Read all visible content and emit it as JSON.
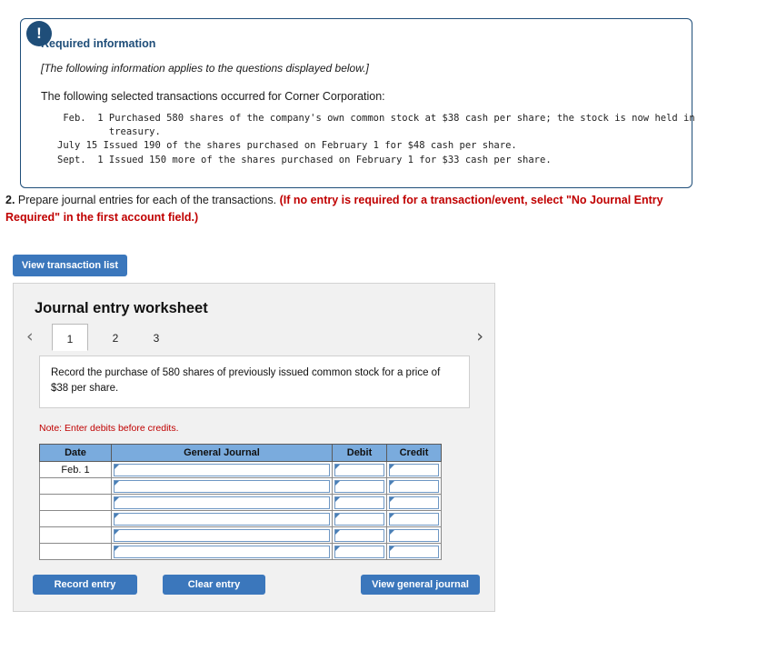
{
  "required_info": {
    "badge_icon": "exclamation-icon",
    "title": "Required information",
    "italic_note": "[The following information applies to the questions displayed below.]",
    "lead": "The following selected transactions occurred for Corner Corporation:",
    "transactions_text": " Feb.  1 Purchased 580 shares of the company's own common stock at $38 cash per share; the stock is now held in\n         treasury.\nJuly 15 Issued 190 of the shares purchased on February 1 for $48 cash per share.\nSept.  1 Issued 150 more of the shares purchased on February 1 for $33 cash per share."
  },
  "question": {
    "number": "2.",
    "text": "Prepare journal entries for each of the transactions.",
    "red_text": "(If no entry is required for a transaction/event, select \"No Journal Entry Required\" in the first account field.)"
  },
  "buttons": {
    "view_transaction_list": "View transaction list",
    "record_entry": "Record entry",
    "clear_entry": "Clear entry",
    "view_general_journal": "View general journal"
  },
  "worksheet": {
    "title": "Journal entry worksheet",
    "prev_arrow": "‹",
    "next_arrow": "›",
    "tabs": [
      {
        "label": "1",
        "active": true
      },
      {
        "label": "2",
        "active": false
      },
      {
        "label": "3",
        "active": false
      }
    ],
    "prompt": "Record the purchase of 580 shares of previously issued common stock for a price of $38 per share.",
    "note": "Note: Enter debits before credits.",
    "table": {
      "headers": [
        "Date",
        "General Journal",
        "Debit",
        "Credit"
      ],
      "rows": [
        {
          "date": "Feb. 1",
          "general_journal": "",
          "debit": "",
          "credit": ""
        },
        {
          "date": "",
          "general_journal": "",
          "debit": "",
          "credit": ""
        },
        {
          "date": "",
          "general_journal": "",
          "debit": "",
          "credit": ""
        },
        {
          "date": "",
          "general_journal": "",
          "debit": "",
          "credit": ""
        },
        {
          "date": "",
          "general_journal": "",
          "debit": "",
          "credit": ""
        },
        {
          "date": "",
          "general_journal": "",
          "debit": "",
          "credit": ""
        }
      ]
    }
  },
  "colors": {
    "navy": "#1f4e79",
    "button_blue": "#3b77bc",
    "table_header_blue": "#7aabdd",
    "red": "#c00000",
    "panel_gray": "#f1f1f1"
  }
}
